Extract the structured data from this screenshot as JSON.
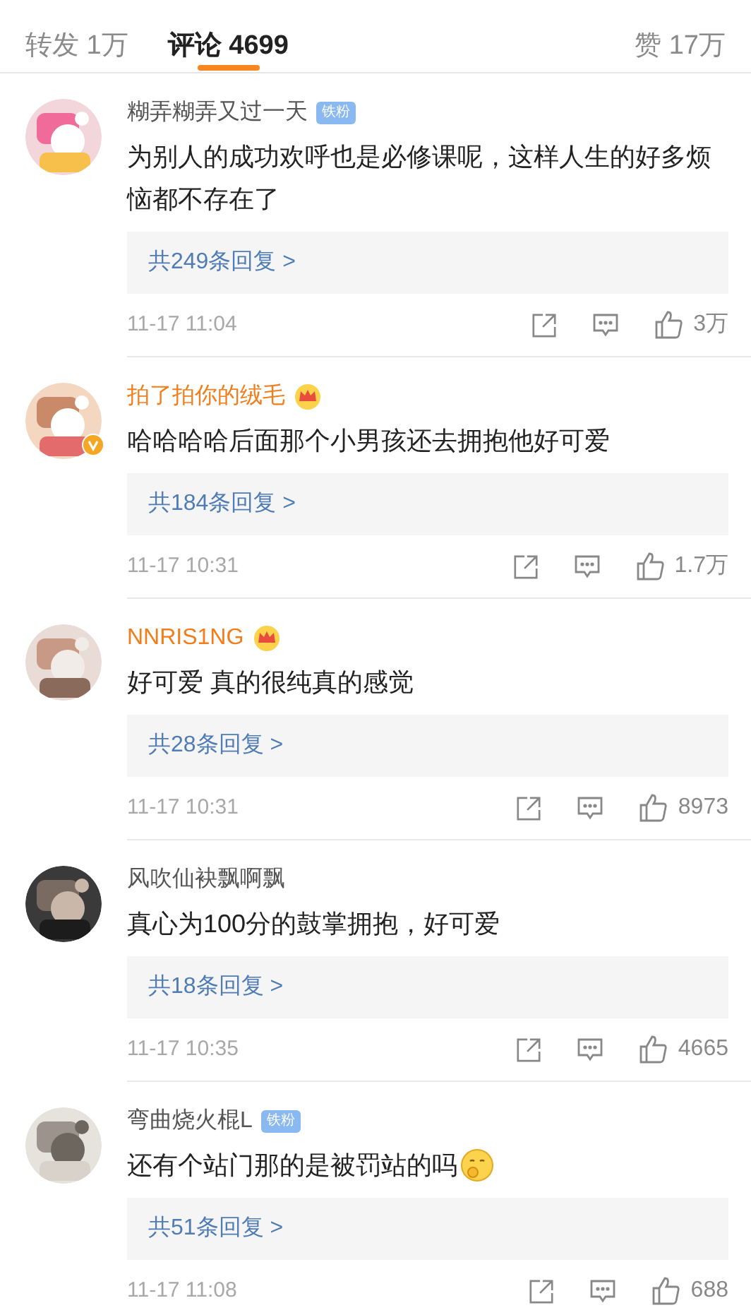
{
  "tabs": [
    {
      "label": "转发 1万",
      "selected": false
    },
    {
      "label": "评论 4699",
      "selected": true
    },
    {
      "label": "赞 17万",
      "selected": false
    }
  ],
  "comments": [
    {
      "name": "糊弄糊弄又过一天",
      "vip": false,
      "badge": {
        "kind": "fan",
        "text": "铁粉"
      },
      "verified": false,
      "text": "为别人的成功欢呼也是必修课呢，这样人生的好多烦恼都不存在了",
      "trailing_emoji": false,
      "replies": "共249条回复 >",
      "time": "11-17 11:04",
      "likes": "3万"
    },
    {
      "name": "拍了拍你的绒毛",
      "vip": true,
      "badge": {
        "kind": "crown"
      },
      "verified": true,
      "text": "哈哈哈哈后面那个小男孩还去拥抱他好可爱",
      "trailing_emoji": false,
      "replies": "共184条回复 >",
      "time": "11-17 10:31",
      "likes": "1.7万"
    },
    {
      "name": "NNRIS1NG",
      "vip": true,
      "badge": {
        "kind": "crown"
      },
      "verified": false,
      "text": "好可爱 真的很纯真的感觉",
      "trailing_emoji": false,
      "replies": "共28条回复 >",
      "time": "11-17 10:31",
      "likes": "8973"
    },
    {
      "name": "风吹仙袂飘啊飘",
      "vip": false,
      "verified": false,
      "text": "真心为100分的鼓掌拥抱，好可爱",
      "trailing_emoji": false,
      "replies": "共18条回复 >",
      "time": "11-17 10:35",
      "likes": "4665"
    },
    {
      "name": "弯曲烧火棍L",
      "vip": false,
      "badge": {
        "kind": "fan",
        "text": "铁粉"
      },
      "verified": false,
      "text": "还有个站门那的是被罚站的吗",
      "trailing_emoji": true,
      "replies": "共51条回复 >",
      "time": "11-17 11:08",
      "likes": "688"
    }
  ]
}
